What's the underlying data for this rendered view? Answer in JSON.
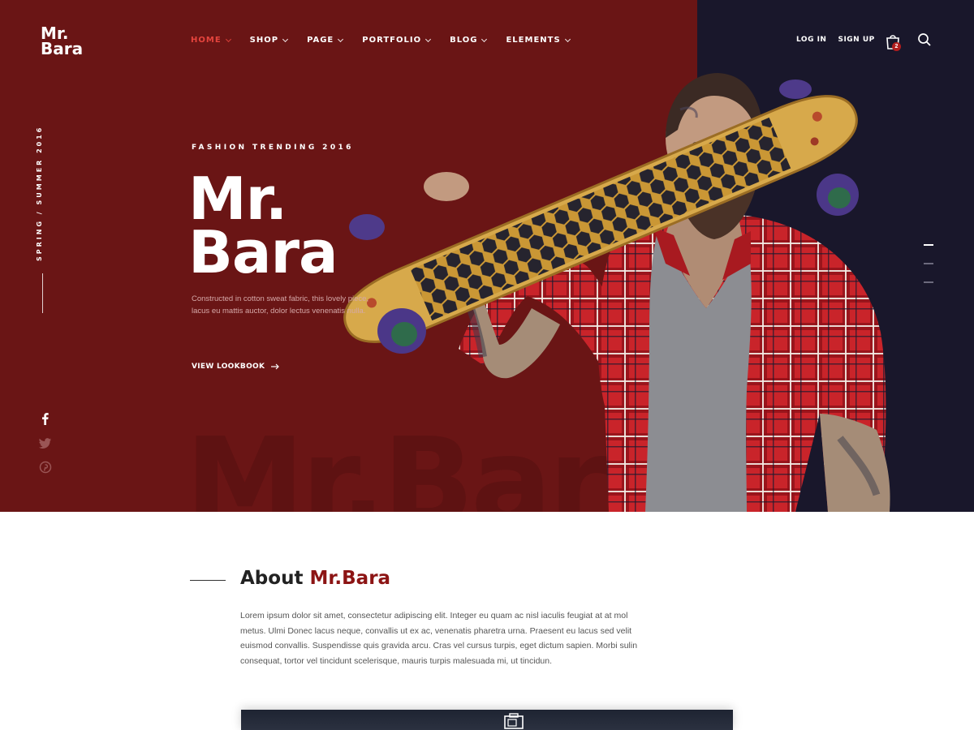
{
  "brand": {
    "line1": "Mr.",
    "line2": "Bara"
  },
  "nav": {
    "items": [
      {
        "label": "HOME",
        "active": true
      },
      {
        "label": "SHOP",
        "active": false
      },
      {
        "label": "PAGE",
        "active": false
      },
      {
        "label": "PORTFOLIO",
        "active": false
      },
      {
        "label": "BLOG",
        "active": false
      },
      {
        "label": "ELEMENTS",
        "active": false
      }
    ],
    "login": "LOG IN",
    "signup": "SIGN UP",
    "cart_count": "2",
    "icons": [
      "shopping-bag-icon",
      "search-icon"
    ]
  },
  "hero": {
    "side_text": "SPRING / SUMMER 2016",
    "eyebrow": "FASHION TRENDING 2016",
    "title_line1": "Mr.",
    "title_line2": "Bara",
    "description": "Constructed in cotton sweat fabric, this lovely piece, lacus eu mattis auctor, dolor lectus venenatis nulla.",
    "cta": "VIEW LOOKBOOK",
    "watermark": "Mr.Bara",
    "social": [
      "facebook-icon",
      "twitter-icon",
      "pinterest-icon"
    ],
    "slides_total": 3,
    "slide_active": 1
  },
  "about": {
    "title_prefix": "About",
    "title_brand": "Mr.Bara",
    "text": "Lorem ipsum dolor sit amet, consectetur adipiscing elit. Integer eu quam ac nisl iaculis feugiat at at mol metus. Ulmi Donec lacus neque, convallis ut ex ac, venenatis pharetra urna. Praesent eu lacus sed velit euismod convallis. Suspendisse quis gravida arcu. Cras vel cursus turpis, eget dictum sapien. Morbi sulin consequat, tortor vel tincidunt scelerisque, mauris turpis malesuada mi, ut tincidun."
  },
  "colors": {
    "hero_red": "#6a1515",
    "hero_dark": "#19172b",
    "accent": "#e5443d",
    "brand_red": "#8c1414"
  }
}
